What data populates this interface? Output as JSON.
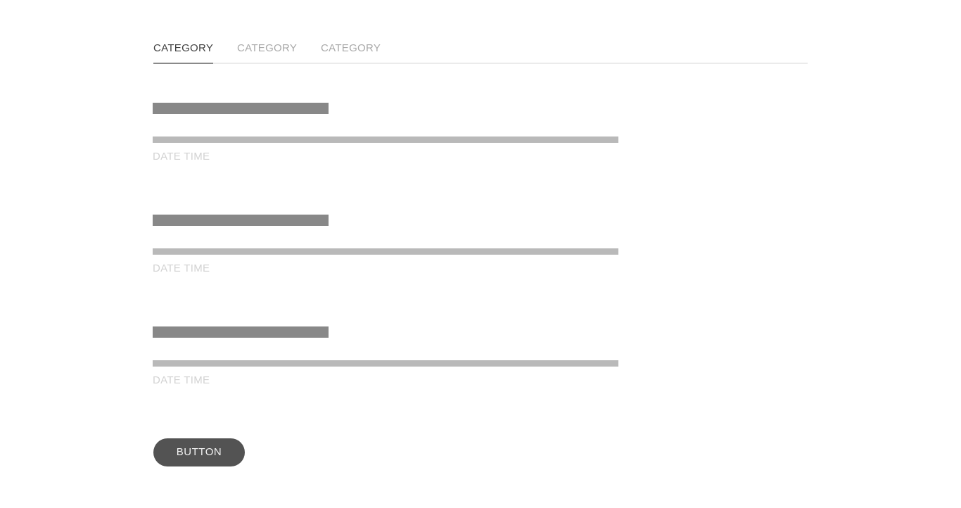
{
  "tabs": [
    {
      "label": "CATEGORY",
      "active": true
    },
    {
      "label": "CATEGORY",
      "active": false
    },
    {
      "label": "CATEGORY",
      "active": false
    }
  ],
  "items": [
    {
      "date": "DATE TIME"
    },
    {
      "date": "DATE TIME"
    },
    {
      "date": "DATE TIME"
    }
  ],
  "button": {
    "label": "BUTTON"
  },
  "colors": {
    "active_tab_text": "#3f3f3f",
    "inactive_tab_text": "#a9a9a9",
    "title_placeholder": "#888888",
    "text_placeholder": "#b9b9b9",
    "date_text": "#d2d2d2",
    "button_bg": "#535353"
  }
}
